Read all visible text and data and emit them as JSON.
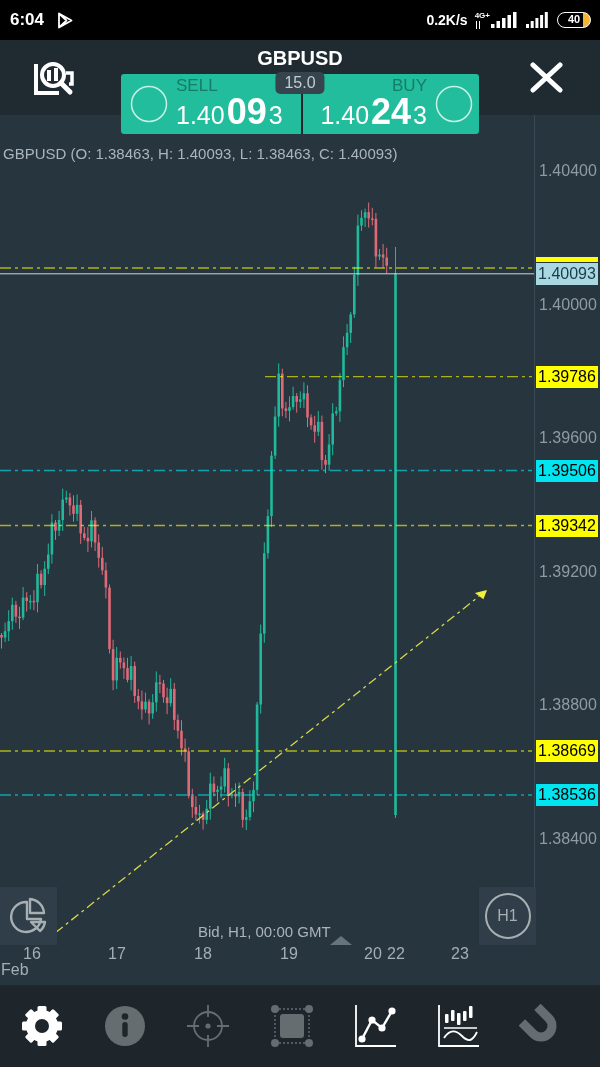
{
  "status_bar": {
    "time": "6:04",
    "speed": "0.2K/s",
    "network": "4G+",
    "battery": "40"
  },
  "header": {
    "title": "GBPUSD"
  },
  "trade_panel": {
    "spread": "15.0",
    "sell": {
      "label": "SELL",
      "price_head": "1.40",
      "price_pips": "09",
      "price_tail": "3"
    },
    "buy": {
      "label": "BUY",
      "price_head": "1.40",
      "price_pips": "24",
      "price_tail": "3"
    }
  },
  "chart": {
    "legend": "GBPUSD (O: 1.38463, H: 1.40093, L: 1.38463, C: 1.40093)",
    "price_ticks": [
      "1.40400",
      "1.40000",
      "1.39600",
      "1.39200",
      "1.38800",
      "1.38400"
    ],
    "current_price": "1.40093",
    "levels": [
      {
        "color": "#ffff00"
      },
      {
        "label": "1.39786",
        "color": "#ffff00"
      },
      {
        "label": "1.39506",
        "color": "#00e5f0"
      },
      {
        "label": "1.39342",
        "color": "#ffff00"
      },
      {
        "label": "1.38669",
        "color": "#ffff00"
      },
      {
        "label": "1.38536",
        "color": "#00e5f0"
      }
    ],
    "date_labels": [
      "16",
      "17",
      "18",
      "19",
      "20",
      "22",
      "23"
    ],
    "month": "Feb",
    "caption": "Bid, H1, 00:00 GMT",
    "timeframe": "H1"
  },
  "toolbar": [
    {
      "kind": "settings",
      "disabled": false
    },
    {
      "kind": "info",
      "disabled": true
    },
    {
      "kind": "crosshair",
      "disabled": true
    },
    {
      "kind": "selection",
      "disabled": true
    },
    {
      "kind": "line_chart",
      "disabled": false
    },
    {
      "kind": "indicators",
      "disabled": false
    },
    {
      "kind": "magnet",
      "disabled": true
    }
  ]
}
